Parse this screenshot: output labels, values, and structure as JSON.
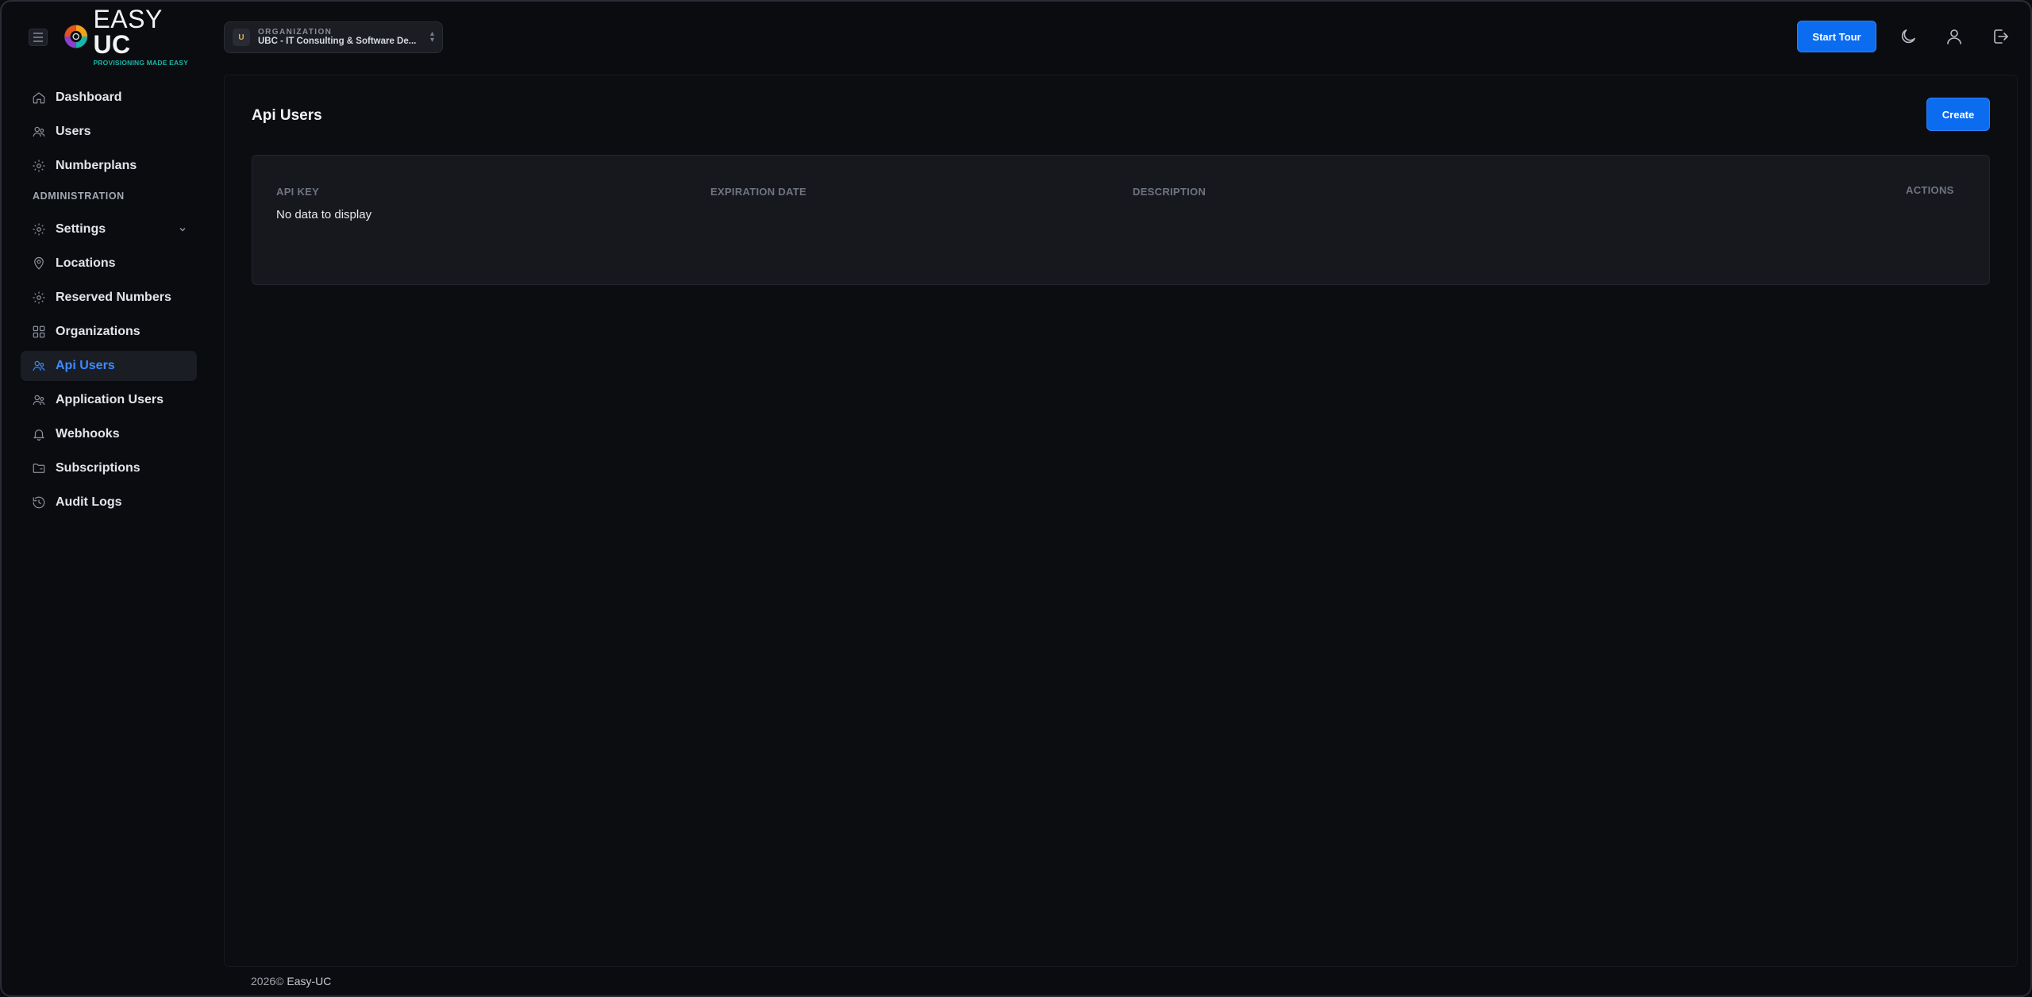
{
  "header": {
    "logo": {
      "brand_main": "EASY",
      "brand_bold": "UC",
      "tagline": "PROVISIONING MADE EASY"
    },
    "organization": {
      "label": "ORGANIZATION",
      "value": "UBC - IT Consulting & Software De...",
      "avatar_letter": "U"
    },
    "start_tour_label": "Start Tour",
    "icons": [
      "theme-moon-icon",
      "user-profile-icon",
      "logout-icon"
    ]
  },
  "sidebar": {
    "items": [
      {
        "label": "Dashboard",
        "icon": "home-icon"
      },
      {
        "label": "Users",
        "icon": "users-icon"
      },
      {
        "label": "Numberplans",
        "icon": "gear-icon"
      }
    ],
    "section_label": "ADMINISTRATION",
    "admin_items": [
      {
        "label": "Settings",
        "icon": "gear-icon",
        "has_chevron": true
      },
      {
        "label": "Locations",
        "icon": "location-pin-icon"
      },
      {
        "label": "Reserved Numbers",
        "icon": "gear-icon"
      },
      {
        "label": "Organizations",
        "icon": "grid-icon"
      },
      {
        "label": "Api Users",
        "icon": "users-icon",
        "active": true
      },
      {
        "label": "Application Users",
        "icon": "users-icon"
      },
      {
        "label": "Webhooks",
        "icon": "bell-icon"
      },
      {
        "label": "Subscriptions",
        "icon": "folder-icon"
      },
      {
        "label": "Audit Logs",
        "icon": "history-icon"
      }
    ]
  },
  "main": {
    "title": "Api Users",
    "create_label": "Create",
    "table": {
      "columns": [
        "API KEY",
        "EXPIRATION DATE",
        "DESCRIPTION",
        "ACTIONS"
      ],
      "empty_text": "No data to display"
    }
  },
  "footer": {
    "year": "2026©",
    "brand": "Easy-UC"
  },
  "colors": {
    "accent": "#0b6cf0",
    "active_text": "#3d8bff",
    "background": "#0b0c10"
  }
}
